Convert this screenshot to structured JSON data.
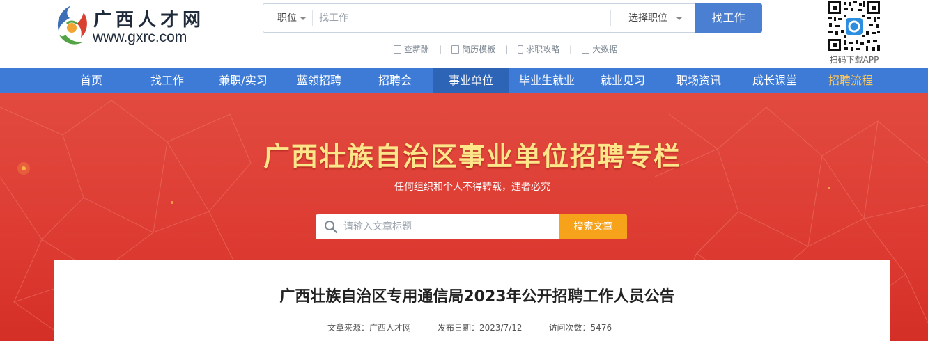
{
  "header": {
    "logo_cn": "广西人才网",
    "logo_en": "www.gxrc.com",
    "search": {
      "category": "职位",
      "placeholder": "找工作",
      "select_label": "选择职位",
      "button": "找工作"
    },
    "quicklinks": [
      {
        "label": "查薪酬",
        "icon": "document-icon"
      },
      {
        "label": "简历模板",
        "icon": "resume-icon"
      },
      {
        "label": "求职攻略",
        "icon": "phone-icon"
      },
      {
        "label": "大数据",
        "icon": "chart-icon"
      }
    ],
    "qr_label": "扫码下载APP"
  },
  "nav": {
    "items": [
      "首页",
      "找工作",
      "兼职/实习",
      "蓝领招聘",
      "招聘会",
      "事业单位",
      "毕业生就业",
      "就业见习",
      "职场资讯",
      "成长课堂",
      "招聘流程"
    ],
    "active": "事业单位",
    "highlight": "招聘流程"
  },
  "banner": {
    "title": "广西壮族自治区事业单位招聘专栏",
    "subtitle": "任何组织和个人不得转载，违者必究",
    "search_placeholder": "请输入文章标题",
    "search_button": "搜索文章"
  },
  "article": {
    "title": "广西壮族自治区专用通信局2023年公开招聘工作人员公告",
    "source": "文章来源：广西人才网",
    "date": "发布日期：2023/7/12",
    "views": "访问次数：5476"
  },
  "colors": {
    "nav_bg": "#3d7bd6",
    "nav_active": "#2d64b5",
    "banner_red": "#dd3b32",
    "title_yellow": "#fde58a",
    "search_orange": "#f7a21b",
    "highlight": "#ffc85a"
  }
}
